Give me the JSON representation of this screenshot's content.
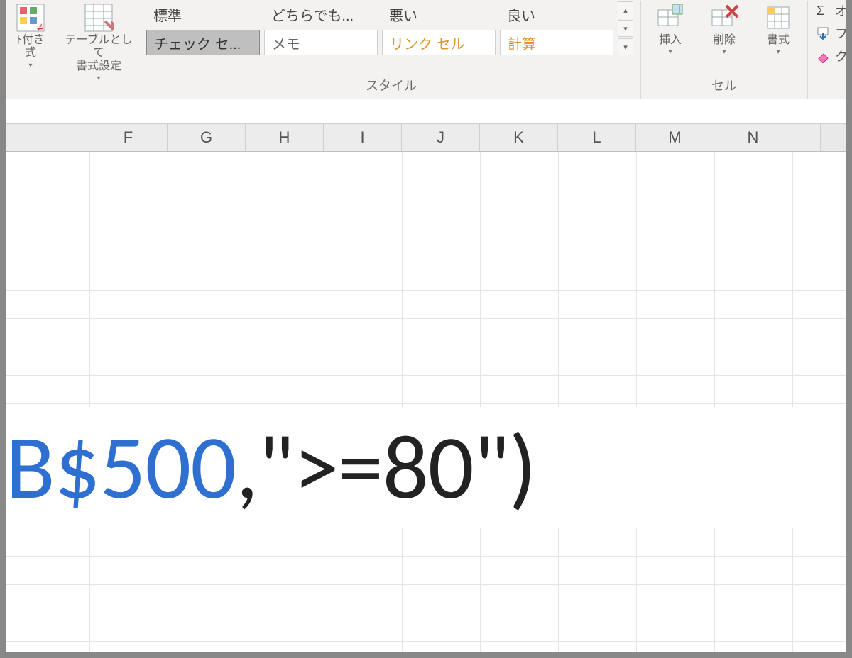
{
  "ribbon": {
    "cond_format_label": "ﾄ付き\n式",
    "table_format_label": "テーブルとして\n書式設定",
    "styles_group_label": "スタイル",
    "cells_group_label": "セル",
    "style_chips": {
      "r0c0": "標準",
      "r0c1": "どちらでも...",
      "r0c2": "悪い",
      "r0c3": "良い",
      "r1c0": "チェック セ...",
      "r1c1": "メモ",
      "r1c2": "リンク セル",
      "r1c3": "計算"
    },
    "insert_label": "挿入",
    "delete_label": "削除",
    "format_label": "書式",
    "autosum_label": "オートS",
    "fill_label": "フィル",
    "clear_label": "クリア"
  },
  "columns": [
    "F",
    "G",
    "H",
    "I",
    "J",
    "K",
    "L",
    "M",
    "N"
  ],
  "formula": {
    "ref": "B$500",
    "rest": ",\">=80\")"
  }
}
